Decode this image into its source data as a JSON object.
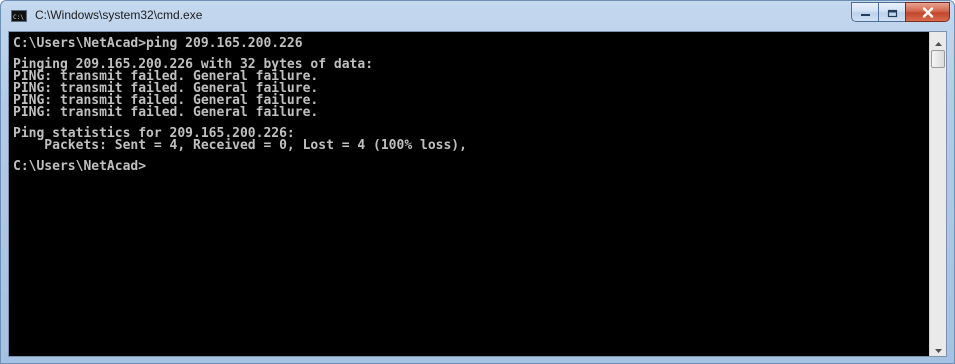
{
  "window": {
    "title": "C:\\Windows\\system32\\cmd.exe",
    "icon": "cmd-console-icon",
    "buttons": {
      "minimize": "minimize-icon",
      "maximize": "maximize-icon",
      "close": "close-icon"
    }
  },
  "console": {
    "lines": [
      "C:\\Users\\NetAcad>ping 209.165.200.226",
      "",
      "Pinging 209.165.200.226 with 32 bytes of data:",
      "PING: transmit failed. General failure.",
      "PING: transmit failed. General failure.",
      "PING: transmit failed. General failure.",
      "PING: transmit failed. General failure.",
      "",
      "Ping statistics for 209.165.200.226:",
      "    Packets: Sent = 4, Received = 0, Lost = 4 (100% loss),",
      "",
      "C:\\Users\\NetAcad>"
    ]
  },
  "colors": {
    "console_background": "#000000",
    "console_text": "#c0c0c0",
    "close_button": "#c3472c"
  }
}
